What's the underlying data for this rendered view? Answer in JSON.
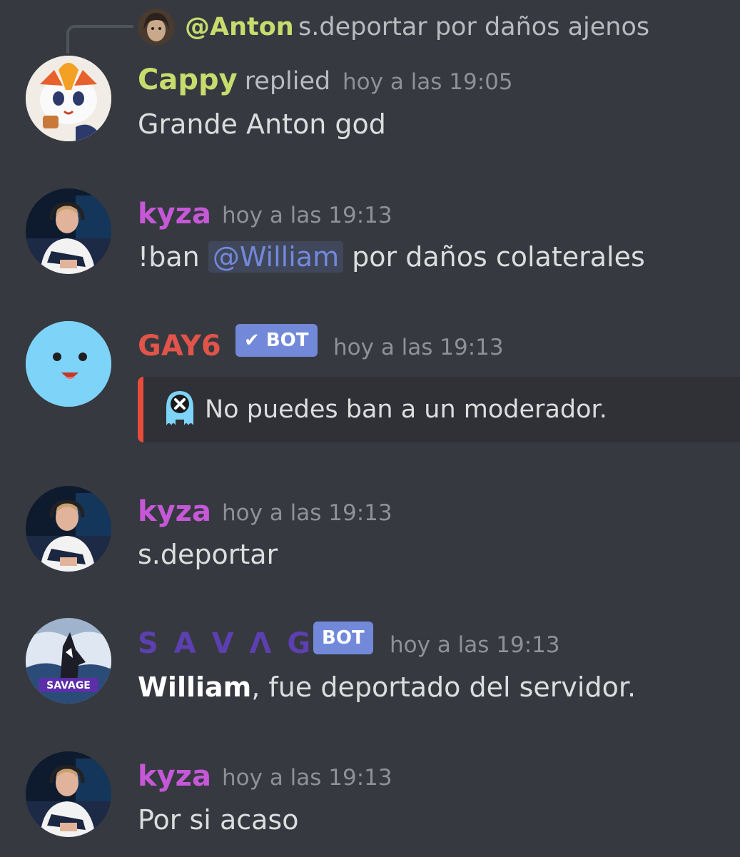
{
  "reply": {
    "author": "@Anton",
    "text": "s.deportar por daños ajenos"
  },
  "messages": [
    {
      "author": "Cappy",
      "author_color": "#c8dc6e",
      "replied_label": "replied",
      "timestamp": "hoy a las 19:05",
      "content": "Grande Anton god"
    },
    {
      "author": "kyza",
      "author_color": "#c658d8",
      "timestamp": "hoy a las 19:13",
      "content_prefix": "!ban ",
      "mention": "@William",
      "content_suffix": " por daños colaterales"
    },
    {
      "author": "GAY6",
      "author_color": "#e0544a",
      "bot_tag": "✔ BOT",
      "timestamp": "hoy a las 19:13",
      "embed_text": "No puedes ban a un moderador.",
      "embed_color": "#e74c3c"
    },
    {
      "author": "kyza",
      "author_color": "#c658d8",
      "timestamp": "hoy a las 19:13",
      "content": "s.deportar"
    },
    {
      "author": "S A V Λ G E",
      "author_color": "#5c3fb0",
      "bot_tag": "BOT",
      "timestamp": "hoy a las 19:13",
      "content_bold": "William",
      "content_rest": ", fue deportado del servidor."
    },
    {
      "author": "kyza",
      "author_color": "#c658d8",
      "timestamp": "hoy a las 19:13",
      "content": "Por si acaso"
    }
  ]
}
